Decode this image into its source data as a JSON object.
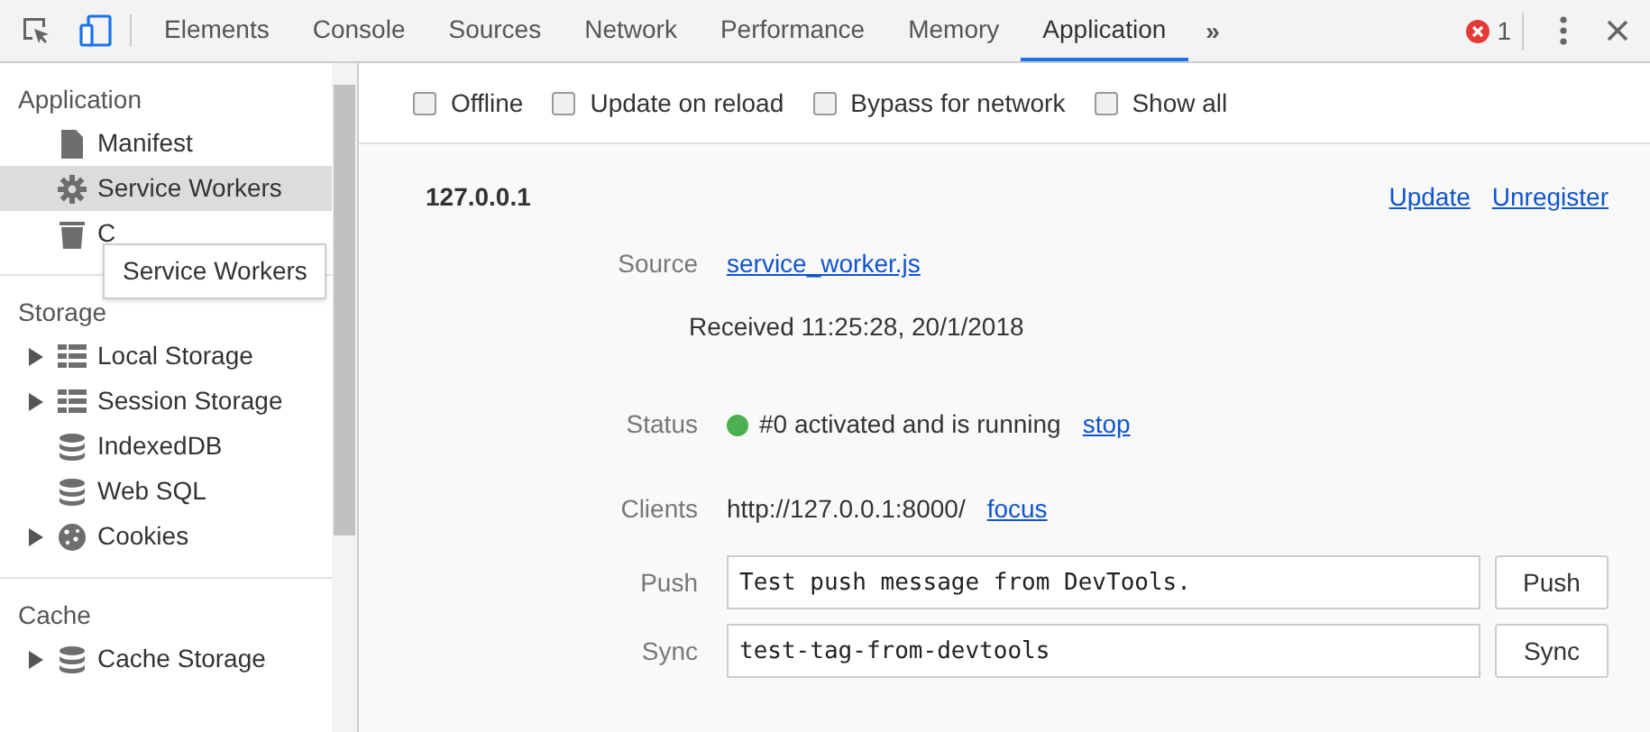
{
  "toolbar": {
    "tabs": [
      {
        "label": "Elements",
        "selected": false
      },
      {
        "label": "Console",
        "selected": false
      },
      {
        "label": "Sources",
        "selected": false
      },
      {
        "label": "Network",
        "selected": false
      },
      {
        "label": "Performance",
        "selected": false
      },
      {
        "label": "Memory",
        "selected": false
      },
      {
        "label": "Application",
        "selected": true
      }
    ],
    "more": "»",
    "error_count": "1"
  },
  "sidebar": {
    "sections": [
      {
        "title": "Application",
        "items": [
          {
            "label": "Manifest",
            "kind": "file",
            "expandable": false,
            "selected": false
          },
          {
            "label": "Service Workers",
            "kind": "gear",
            "expandable": false,
            "selected": true
          },
          {
            "label": "C",
            "kind": "trash",
            "expandable": false,
            "selected": false
          }
        ]
      },
      {
        "title": "Storage",
        "items": [
          {
            "label": "Local Storage",
            "kind": "grid",
            "expandable": true,
            "selected": false
          },
          {
            "label": "Session Storage",
            "kind": "grid",
            "expandable": true,
            "selected": false
          },
          {
            "label": "IndexedDB",
            "kind": "db",
            "expandable": false,
            "selected": false
          },
          {
            "label": "Web SQL",
            "kind": "db",
            "expandable": false,
            "selected": false
          },
          {
            "label": "Cookies",
            "kind": "cookie",
            "expandable": true,
            "selected": false
          }
        ]
      },
      {
        "title": "Cache",
        "items": [
          {
            "label": "Cache Storage",
            "kind": "db",
            "expandable": true,
            "selected": false
          }
        ]
      }
    ],
    "tooltip": "Service Workers"
  },
  "options": [
    {
      "label": "Offline",
      "checked": false
    },
    {
      "label": "Update on reload",
      "checked": false
    },
    {
      "label": "Bypass for network",
      "checked": false
    },
    {
      "label": "Show all",
      "checked": false
    }
  ],
  "worker": {
    "origin": "127.0.0.1",
    "actions": [
      "Update",
      "Unregister"
    ],
    "source": {
      "label": "Source",
      "link": "service_worker.js",
      "received": "Received 11:25:28, 20/1/2018"
    },
    "status": {
      "label": "Status",
      "color": "#4caf50",
      "text": "#0 activated and is running",
      "link": "stop"
    },
    "clients": {
      "label": "Clients",
      "text": "http://127.0.0.1:8000/",
      "link": "focus"
    },
    "push": {
      "label": "Push",
      "value": "Test push message from DevTools.",
      "button": "Push"
    },
    "sync": {
      "label": "Sync",
      "value": "test-tag-from-devtools",
      "button": "Sync"
    }
  }
}
